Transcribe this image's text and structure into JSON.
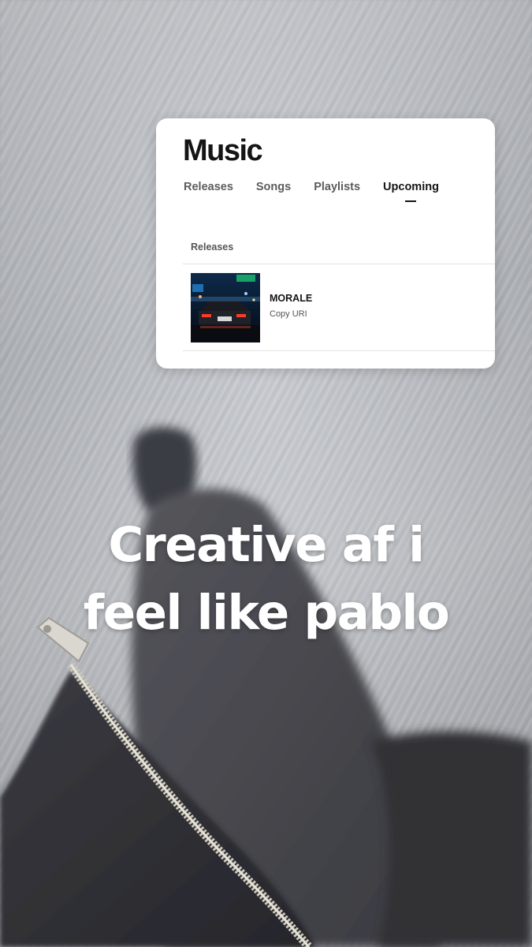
{
  "card": {
    "title": "Music",
    "tabs": [
      {
        "label": "Releases",
        "active": false
      },
      {
        "label": "Songs",
        "active": false
      },
      {
        "label": "Playlists",
        "active": false
      },
      {
        "label": "Upcoming",
        "active": true
      }
    ],
    "section_label": "Releases",
    "releases": [
      {
        "title": "MORALE",
        "action": "Copy URI",
        "cover_icon": "night-street-car-cover"
      }
    ]
  },
  "caption": {
    "line1": "Creative af i",
    "line2": "feel like pablo"
  },
  "colors": {
    "card_bg": "#ffffff",
    "text_primary": "#141414",
    "text_secondary": "#5c5c5c",
    "caption_text": "#ffffff"
  }
}
